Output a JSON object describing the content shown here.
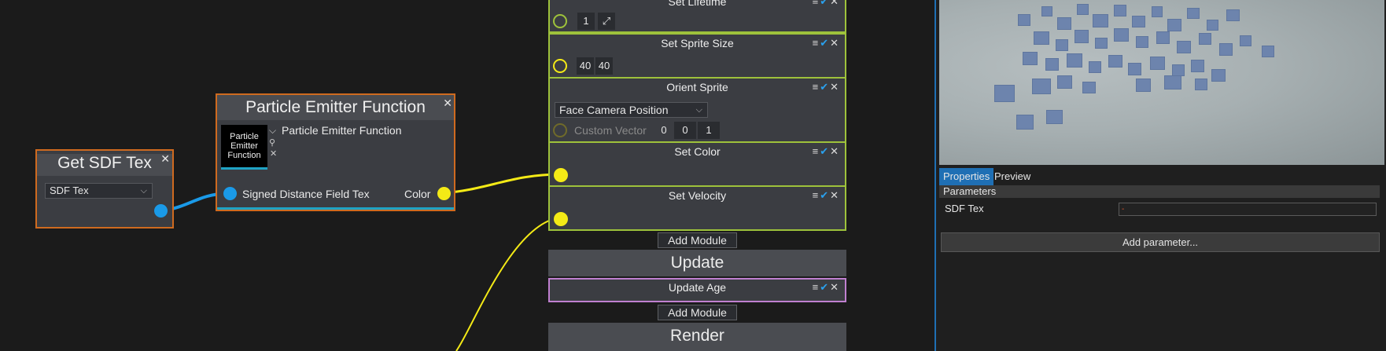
{
  "graph": {
    "get_sdf_tex_node": {
      "title": "Get SDF Tex",
      "close": "✕",
      "dropdown_value": "SDF Tex",
      "chevron": "⌵"
    },
    "function_node": {
      "title": "Particle Emitter Function",
      "close": "✕",
      "thumbnail_text": "Particle Emitter Function",
      "asset_label": "Particle Emitter Function",
      "input_label": "Signed Distance Field Tex",
      "output_label": "Color",
      "chevron": "⌵",
      "magnifier": "⚲",
      "clear": "✕"
    }
  },
  "emitter": {
    "modules": [
      {
        "title": "Set Lifetime",
        "value": "1",
        "expand": "⤢"
      },
      {
        "title": "Set Sprite Size",
        "values": [
          "40",
          "40"
        ]
      },
      {
        "title": "Orient Sprite",
        "dropdown": "Face Camera Position",
        "chevron": "⌵",
        "custom_vector_label": "Custom Vector",
        "custom_vector": [
          "0",
          "0",
          "1"
        ]
      },
      {
        "title": "Set Color"
      },
      {
        "title": "Set Velocity"
      }
    ],
    "module_icons": {
      "menu": "≡",
      "check": "✔",
      "close": "✕"
    },
    "add_module_label": "Add Module",
    "update_section": "Update",
    "update_modules": [
      {
        "title": "Update Age"
      }
    ],
    "render_section": "Render"
  },
  "properties": {
    "tabs": [
      "Properties",
      "Preview"
    ],
    "active_tab": "Properties",
    "section_header": "Parameters",
    "param_name": "SDF Tex",
    "param_value": "-",
    "add_parameter_label": "Add parameter..."
  },
  "colors": {
    "node_border": "#cf6a1f",
    "module_border": "#9ec23b",
    "update_module_border": "#c080d0",
    "pin_blue": "#1a9ae8",
    "pin_yellow": "#f4ea16",
    "accent": "#1f6fb4"
  }
}
